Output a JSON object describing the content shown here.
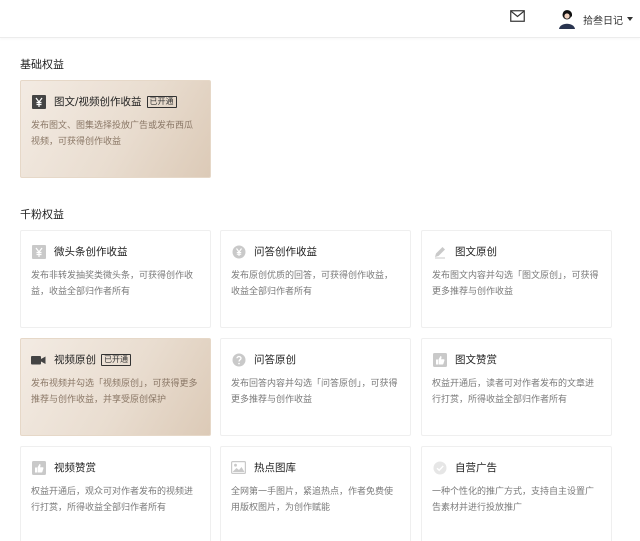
{
  "header": {
    "mail_icon": "mail-icon",
    "username": "拾叁日记",
    "dropdown_icon": "caret-down-icon"
  },
  "sections": [
    {
      "title": "基础权益",
      "cards": [
        {
          "title": "图文/视频创作收益",
          "badge": "已开通",
          "desc": "发布图文、图集选择投放广告或发布西瓜视频，可获得创作收益",
          "icon": "yuan-icon",
          "highlight": true
        }
      ]
    },
    {
      "title": "千粉权益",
      "cards": [
        {
          "title": "微头条创作收益",
          "desc": "发布非转发抽奖类微头条，可获得创作收益，收益全部归作者所有",
          "icon": "yuan-icon"
        },
        {
          "title": "问答创作收益",
          "desc": "发布原创优质的回答，可获得创作收益，收益全部归作者所有",
          "icon": "yuan-circle-icon"
        },
        {
          "title": "图文原创",
          "desc": "发布图文内容并勾选「图文原创」，可获得更多推荐与创作收益",
          "icon": "pen-icon"
        },
        {
          "title": "视频原创",
          "badge": "已开通",
          "desc": "发布视频并勾选「视频原创」，可获得更多推荐与创作收益，并享受原创保护",
          "icon": "video-camera-icon",
          "highlight": true
        },
        {
          "title": "问答原创",
          "desc": "发布回答内容并勾选「问答原创」，可获得更多推荐与创作收益",
          "icon": "question-icon"
        },
        {
          "title": "图文赞赏",
          "desc": "权益开通后，读者可对作者发布的文章进行打赏，所得收益全部归作者所有",
          "icon": "thumb-up-icon"
        },
        {
          "title": "视频赞赏",
          "desc": "权益开通后，观众可对作者发布的视频进行打赏，所得收益全部归作者所有",
          "icon": "thumb-up-icon"
        },
        {
          "title": "热点图库",
          "desc": "全网第一手图片，紧追热点，作者免费使用版权图片，为创作赋能",
          "icon": "image-icon"
        },
        {
          "title": "自营广告",
          "desc": "一种个性化的推广方式，支持自主设置广告素材并进行投放推广",
          "icon": "check-circle-icon"
        }
      ]
    }
  ],
  "colors": {
    "highlight_gradient": [
      "#f3ebe3",
      "#dccab7"
    ],
    "icon_gray": "#c9c9c9",
    "icon_dark": "#444444"
  }
}
